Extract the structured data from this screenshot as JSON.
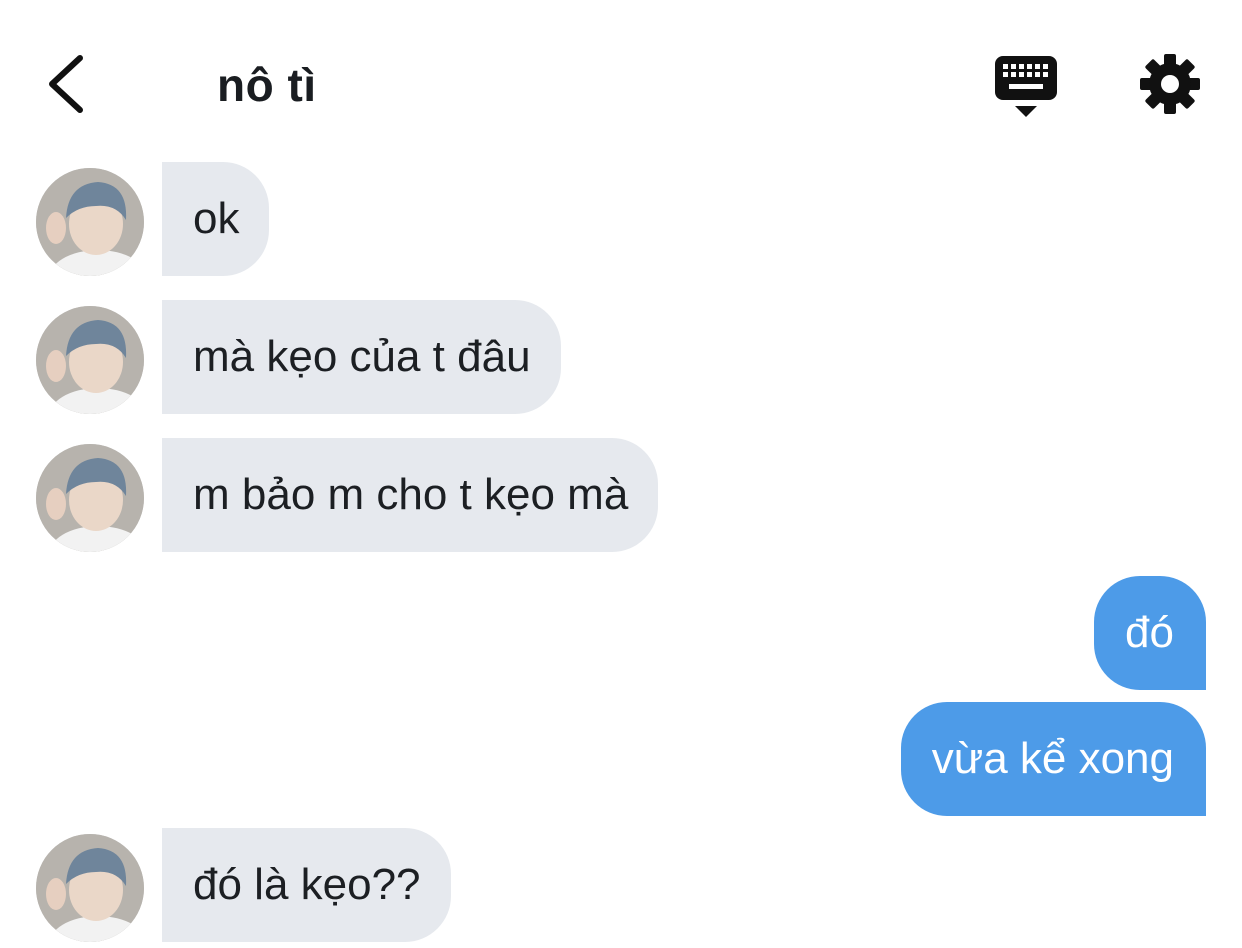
{
  "header": {
    "title": "nô tì",
    "back_icon": "chevron-left-icon",
    "keyboard_icon": "keyboard-dismiss-icon",
    "settings_icon": "gear-icon"
  },
  "colors": {
    "incoming_bubble": "#e6e9ee",
    "outgoing_bubble": "#4d9be8",
    "background": "#ffffff"
  },
  "messages": [
    {
      "from": "them",
      "text": "ok"
    },
    {
      "from": "them",
      "text": "mà kẹo của t đâu"
    },
    {
      "from": "them",
      "text": "m bảo m cho t kẹo mà"
    },
    {
      "from": "me",
      "text": "đó"
    },
    {
      "from": "me",
      "text": "vừa kể xong"
    },
    {
      "from": "them",
      "text": "đó là kẹo??"
    }
  ]
}
